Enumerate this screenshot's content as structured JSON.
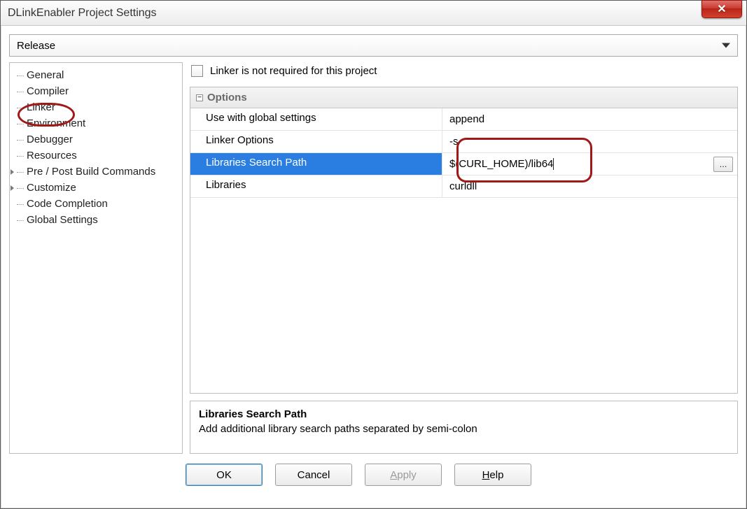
{
  "window": {
    "title": "DLinkEnabler Project Settings"
  },
  "config": {
    "selected": "Release"
  },
  "sidebar": {
    "items": [
      {
        "label": "General",
        "expando": false
      },
      {
        "label": "Compiler",
        "expando": false
      },
      {
        "label": "Linker",
        "expando": false,
        "circled": true
      },
      {
        "label": "Environment",
        "expando": false
      },
      {
        "label": "Debugger",
        "expando": false
      },
      {
        "label": "Resources",
        "expando": false
      },
      {
        "label": "Pre / Post Build Commands",
        "expando": true
      },
      {
        "label": "Customize",
        "expando": true
      },
      {
        "label": "Code Completion",
        "expando": false
      },
      {
        "label": "Global Settings",
        "expando": false
      }
    ]
  },
  "linker_not_required_label": "Linker is not required for this project",
  "linker_not_required_checked": false,
  "options_header": "Options",
  "options": {
    "rows": [
      {
        "label": "Use with global settings",
        "value": "append",
        "selected": false,
        "browse": false
      },
      {
        "label": "Linker Options",
        "value": "-s",
        "selected": false,
        "browse": false
      },
      {
        "label": "Libraries Search Path",
        "value": "$(CURL_HOME)/lib64",
        "selected": true,
        "browse": true,
        "editing": true
      },
      {
        "label": "Libraries",
        "value": "curldll",
        "selected": false,
        "browse": false
      }
    ]
  },
  "help": {
    "title": "Libraries Search Path",
    "desc": "Add additional library search paths separated by semi-colon"
  },
  "buttons": {
    "ok": "OK",
    "cancel": "Cancel",
    "apply": "Apply",
    "help": "Help"
  }
}
